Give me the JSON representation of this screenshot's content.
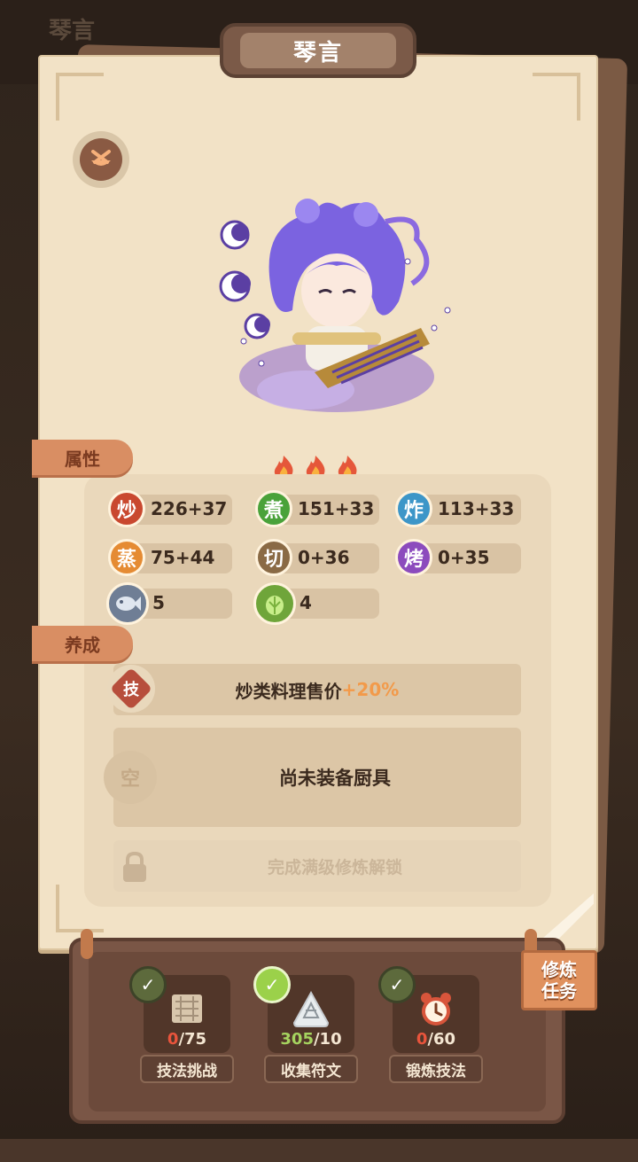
{
  "background": {
    "top_text": "琴言"
  },
  "header": {
    "title": "琴言"
  },
  "sections": {
    "attributes": "属性",
    "training": "养成"
  },
  "stats": [
    {
      "glyph": "炒",
      "value": "226+37",
      "color": "#c9482f"
    },
    {
      "glyph": "煮",
      "value": "151+33",
      "color": "#4aa23a"
    },
    {
      "glyph": "炸",
      "value": "113+33",
      "color": "#3d96c8"
    },
    {
      "glyph": "蒸",
      "value": "75+44",
      "color": "#e58b33"
    },
    {
      "glyph": "切",
      "value": "0+36",
      "color": "#8a6a45"
    },
    {
      "glyph": "烤",
      "value": "0+35",
      "color": "#8c4bbd"
    },
    {
      "glyph": "",
      "value": "5",
      "color": "#6f7e95"
    },
    {
      "glyph": "",
      "value": "4",
      "color": "#6fa53a"
    }
  ],
  "skill": {
    "badge": "技",
    "text": "炒类料理售价",
    "bonus": "+20%"
  },
  "equipment": {
    "badge": "空",
    "text": "尚未装备厨具"
  },
  "locked": {
    "text": "完成满级修炼解锁"
  },
  "tasks": [
    {
      "current": "0",
      "total": "/75",
      "label": "技法挑战",
      "done": false
    },
    {
      "current": "305",
      "total": "/10",
      "label": "收集符文",
      "done": true
    },
    {
      "current": "0",
      "total": "/60",
      "label": "锻炼技法",
      "done": false
    }
  ],
  "train_button": {
    "line1": "修炼",
    "line2": "任务"
  },
  "colors": {
    "accent": "#d98e63",
    "paper": "#f2e2c6",
    "frame": "#7a5646"
  }
}
